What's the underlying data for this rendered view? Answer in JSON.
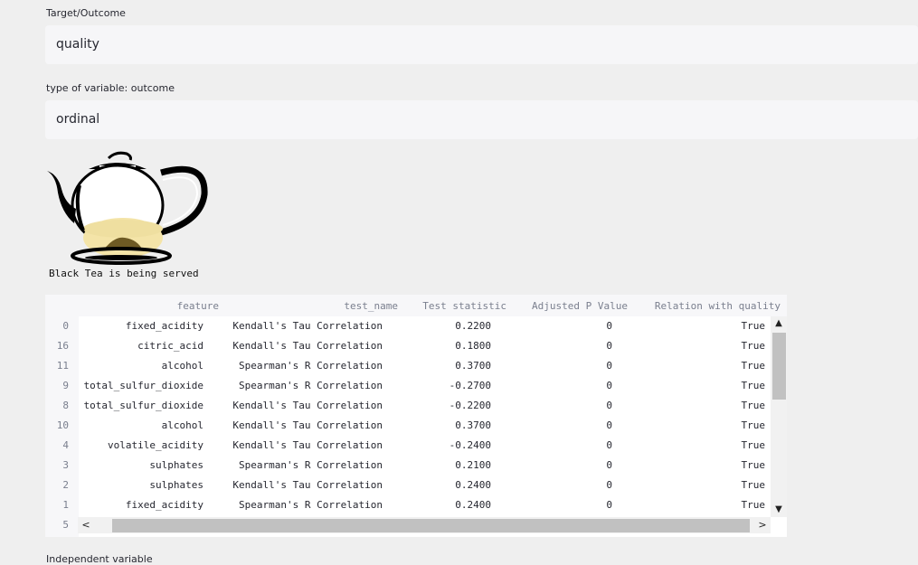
{
  "target": {
    "label": "Target/Outcome",
    "value": "quality"
  },
  "variable_type": {
    "label": "type of variable: outcome",
    "value": "ordinal"
  },
  "image": {
    "icon": "teapot-icon",
    "caption": "Black Tea is being served"
  },
  "table": {
    "columns": [
      "feature",
      "test_name",
      "Test statistic",
      "Adjusted P Value",
      "Relation with quality"
    ],
    "rows": [
      {
        "index": "0",
        "feature": "fixed_acidity",
        "test_name": "Kendall's Tau Correlation",
        "stat": "0.2200",
        "p": "0",
        "relation": "True"
      },
      {
        "index": "16",
        "feature": "citric_acid",
        "test_name": "Kendall's Tau Correlation",
        "stat": "0.1800",
        "p": "0",
        "relation": "True"
      },
      {
        "index": "11",
        "feature": "alcohol",
        "test_name": "Spearman's R Correlation",
        "stat": "0.3700",
        "p": "0",
        "relation": "True"
      },
      {
        "index": "9",
        "feature": "total_sulfur_dioxide",
        "test_name": "Spearman's R Correlation",
        "stat": "-0.2700",
        "p": "0",
        "relation": "True"
      },
      {
        "index": "8",
        "feature": "total_sulfur_dioxide",
        "test_name": "Kendall's Tau Correlation",
        "stat": "-0.2200",
        "p": "0",
        "relation": "True"
      },
      {
        "index": "10",
        "feature": "alcohol",
        "test_name": "Kendall's Tau Correlation",
        "stat": "0.3700",
        "p": "0",
        "relation": "True"
      },
      {
        "index": "4",
        "feature": "volatile_acidity",
        "test_name": "Kendall's Tau Correlation",
        "stat": "-0.2400",
        "p": "0",
        "relation": "True"
      },
      {
        "index": "3",
        "feature": "sulphates",
        "test_name": "Spearman's R Correlation",
        "stat": "0.2100",
        "p": "0",
        "relation": "True"
      },
      {
        "index": "2",
        "feature": "sulphates",
        "test_name": "Kendall's Tau Correlation",
        "stat": "0.2400",
        "p": "0",
        "relation": "True"
      },
      {
        "index": "1",
        "feature": "fixed_acidity",
        "test_name": "Spearman's R Correlation",
        "stat": "0.2400",
        "p": "0",
        "relation": "True"
      },
      {
        "index": "5",
        "feature": "",
        "test_name": "",
        "stat": "",
        "p": "",
        "relation": ""
      }
    ]
  },
  "scrollbar": {
    "up": "▲",
    "down": "▼",
    "left": "<",
    "right": ">"
  },
  "next_section": {
    "label": "Independent variable"
  }
}
